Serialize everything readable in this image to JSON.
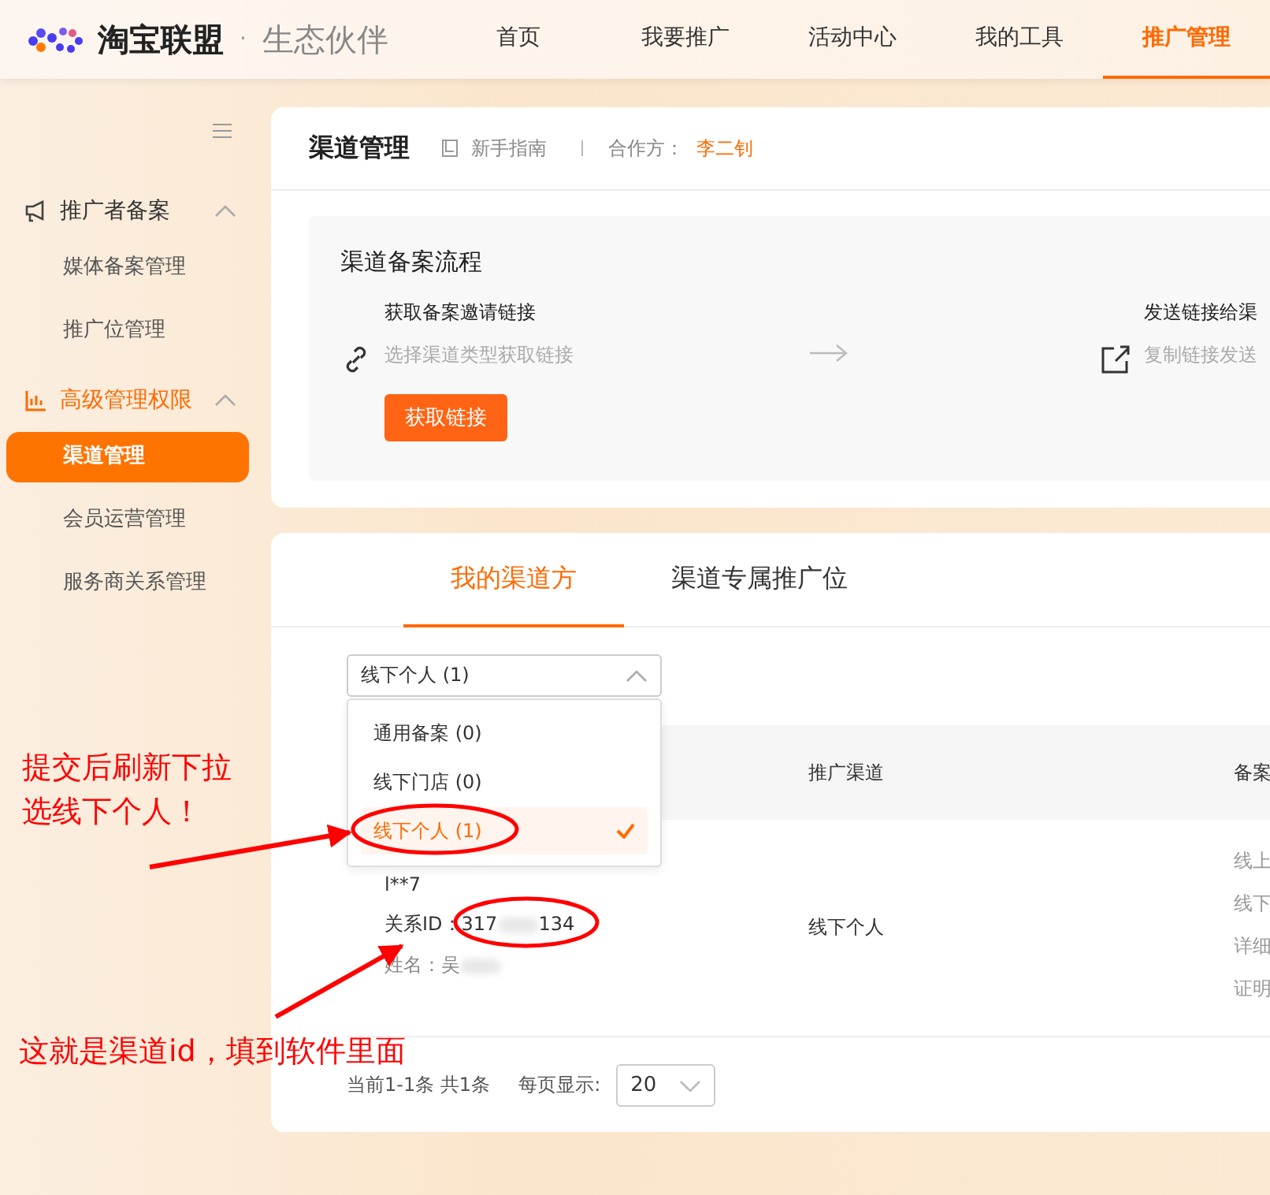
{
  "header": {
    "logo": "淘宝联盟",
    "logo_sep": "·",
    "logo_sub": "生态伙伴",
    "nav": [
      {
        "label": "首页",
        "selected": false
      },
      {
        "label": "我要推广",
        "selected": false
      },
      {
        "label": "活动中心",
        "selected": false
      },
      {
        "label": "我的工具",
        "selected": false
      },
      {
        "label": "推广管理",
        "selected": true
      }
    ]
  },
  "sidebar": {
    "groups": [
      {
        "label": "推广者备案",
        "active": false,
        "expanded": true,
        "items": [
          {
            "label": "媒体备案管理",
            "selected": false
          },
          {
            "label": "推广位管理",
            "selected": false
          }
        ]
      },
      {
        "label": "高级管理权限",
        "active": true,
        "expanded": true,
        "items": [
          {
            "label": "渠道管理",
            "selected": true
          },
          {
            "label": "会员运营管理",
            "selected": false
          },
          {
            "label": "服务商关系管理",
            "selected": false
          }
        ]
      }
    ]
  },
  "page": {
    "title": "渠道管理",
    "guide": "新手指南",
    "partner_label": "合作方：",
    "partner": "李二钊"
  },
  "process": {
    "title": "渠道备案流程",
    "steps": [
      {
        "title": "获取备案邀请链接",
        "desc": "选择渠道类型获取链接",
        "button": "获取链接"
      },
      {
        "title": "发送链接给渠",
        "desc": "复制链接发送"
      }
    ]
  },
  "tabs": [
    {
      "label": "我的渠道方",
      "selected": true
    },
    {
      "label": "渠道专属推广位",
      "selected": false
    }
  ],
  "filter": {
    "value": "线下个人 (1)",
    "expanded": true,
    "options": [
      {
        "label": "通用备案 (0)",
        "selected": false
      },
      {
        "label": "线下门店 (0)",
        "selected": false
      },
      {
        "label": "线下个人 (1)",
        "selected": true
      }
    ]
  },
  "table": {
    "columns": [
      "推广渠道",
      "备案"
    ],
    "rows": [
      {
        "account": "l**7",
        "id_text": "关系ID：317",
        "id_end": "134",
        "name_text": "姓名：吴",
        "channel": "线下个人",
        "status_lines": [
          "线上",
          "线下",
          "详细",
          "证明"
        ]
      }
    ]
  },
  "pagination": {
    "summary": "当前1-1条 共1条",
    "page_size_label": "每页显示:",
    "page_size": "20"
  },
  "annotations": [
    {
      "text": "提交后刷新下拉选线下个人！"
    },
    {
      "text": "这就是渠道id，填到软件里面"
    }
  ]
}
